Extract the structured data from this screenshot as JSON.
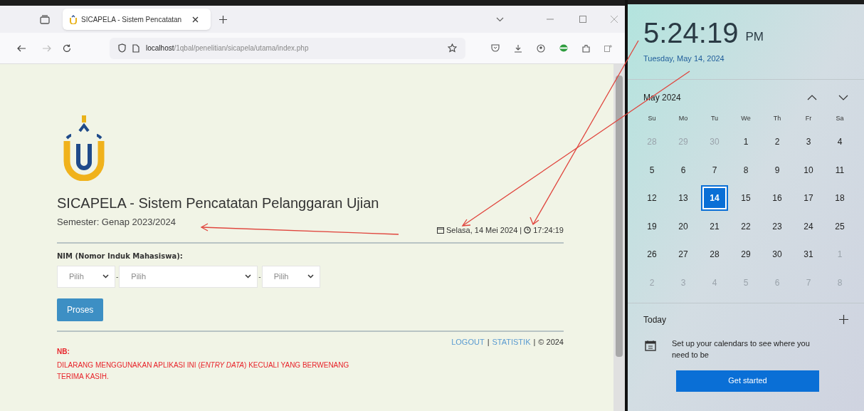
{
  "browser": {
    "tab": {
      "title": "SICAPELA - Sistem Pencatatan",
      "selected": true
    },
    "url": {
      "host": "localhost",
      "path": "/1qbal/penelitian/sicapela/utama/index.php"
    }
  },
  "page": {
    "title": "SICAPELA - Sistem Pencatatan Pelanggaran Ujian",
    "semester": "Semester: Genap 2023/2024",
    "date": "Selasa, 14 Mei 2024",
    "separator": "|",
    "time": "17:24:19",
    "nim_label": "NIM (Nomor Induk Mahasiswa):",
    "selects": [
      {
        "value": "Pilih"
      },
      {
        "value": "Pilih"
      },
      {
        "value": "Pilih"
      }
    ],
    "select_separator": "-",
    "submit": "Proses",
    "footer": {
      "links": [
        "LOGOUT",
        "STATISTIK"
      ],
      "separator": "|",
      "copyright": "© 2024"
    },
    "notice": {
      "heading": "NB:",
      "lines": [
        "DILARANG MENGGUNAKAN APLIKASI INI (*ENTRY DATA*) KECUALI YANG BERWENANG",
        "TERIMA KASIH."
      ]
    }
  },
  "clock_panel": {
    "time": "5:24:19",
    "ampm": "PM",
    "date": "Tuesday, May 14, 2024",
    "month": "May 2024",
    "weekdays": [
      "Su",
      "Mo",
      "Tu",
      "We",
      "Th",
      "Fr",
      "Sa"
    ],
    "days": [
      {
        "label": "28",
        "other_month": true,
        "selected": false
      },
      {
        "label": "29",
        "other_month": true,
        "selected": false
      },
      {
        "label": "30",
        "other_month": true,
        "selected": false
      },
      {
        "label": "1",
        "other_month": false,
        "selected": false
      },
      {
        "label": "2",
        "other_month": false,
        "selected": false
      },
      {
        "label": "3",
        "other_month": false,
        "selected": false
      },
      {
        "label": "4",
        "other_month": false,
        "selected": false
      },
      {
        "label": "5",
        "other_month": false,
        "selected": false
      },
      {
        "label": "6",
        "other_month": false,
        "selected": false
      },
      {
        "label": "7",
        "other_month": false,
        "selected": false
      },
      {
        "label": "8",
        "other_month": false,
        "selected": false
      },
      {
        "label": "9",
        "other_month": false,
        "selected": false
      },
      {
        "label": "10",
        "other_month": false,
        "selected": false
      },
      {
        "label": "11",
        "other_month": false,
        "selected": false
      },
      {
        "label": "12",
        "other_month": false,
        "selected": false
      },
      {
        "label": "13",
        "other_month": false,
        "selected": false
      },
      {
        "label": "14",
        "other_month": false,
        "selected": true
      },
      {
        "label": "15",
        "other_month": false,
        "selected": false
      },
      {
        "label": "16",
        "other_month": false,
        "selected": false
      },
      {
        "label": "17",
        "other_month": false,
        "selected": false
      },
      {
        "label": "18",
        "other_month": false,
        "selected": false
      },
      {
        "label": "19",
        "other_month": false,
        "selected": false
      },
      {
        "label": "20",
        "other_month": false,
        "selected": false
      },
      {
        "label": "21",
        "other_month": false,
        "selected": false
      },
      {
        "label": "22",
        "other_month": false,
        "selected": false
      },
      {
        "label": "23",
        "other_month": false,
        "selected": false
      },
      {
        "label": "24",
        "other_month": false,
        "selected": false
      },
      {
        "label": "25",
        "other_month": false,
        "selected": false
      },
      {
        "label": "26",
        "other_month": false,
        "selected": false
      },
      {
        "label": "27",
        "other_month": false,
        "selected": false
      },
      {
        "label": "28",
        "other_month": false,
        "selected": false
      },
      {
        "label": "29",
        "other_month": false,
        "selected": false
      },
      {
        "label": "30",
        "other_month": false,
        "selected": false
      },
      {
        "label": "31",
        "other_month": false,
        "selected": false
      },
      {
        "label": "1",
        "other_month": true,
        "selected": false
      },
      {
        "label": "2",
        "other_month": true,
        "selected": false
      },
      {
        "label": "3",
        "other_month": true,
        "selected": false
      },
      {
        "label": "4",
        "other_month": true,
        "selected": false
      },
      {
        "label": "5",
        "other_month": true,
        "selected": false
      },
      {
        "label": "6",
        "other_month": true,
        "selected": false
      },
      {
        "label": "7",
        "other_month": true,
        "selected": false
      },
      {
        "label": "8",
        "other_month": true,
        "selected": false
      }
    ],
    "agenda_heading": "Today",
    "agenda_message": "Set up your calendars to see where you need to be",
    "get_started": "Get started"
  }
}
